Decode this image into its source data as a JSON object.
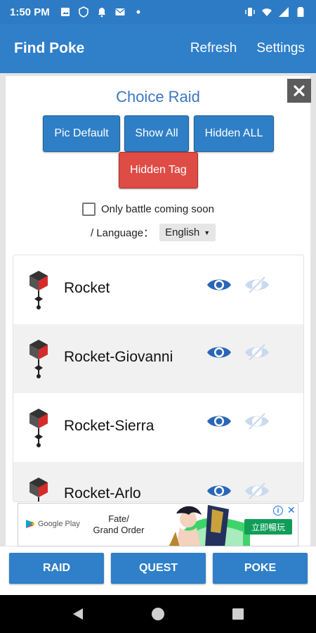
{
  "status_bar": {
    "time": "1:50 PM",
    "left_icons": [
      "photo-icon",
      "shield-icon",
      "bell-icon",
      "mail-icon",
      "dot-icon"
    ],
    "right_icons": [
      "vibrate-icon",
      "wifi-icon",
      "signal-icon",
      "battery-icon"
    ]
  },
  "app_bar": {
    "title": "Find Poke",
    "actions": [
      "Refresh",
      "Settings"
    ]
  },
  "dialog": {
    "title": "Choice Raid",
    "buttons": {
      "pic_default": "Pic Default",
      "show_all": "Show All",
      "hidden_all": "Hidden ALL",
      "hidden_tag": "Hidden Tag"
    },
    "checkbox_label": "Only battle coming soon",
    "checkbox_checked": false,
    "language_label": "/  Language：",
    "language_value": "English",
    "items": [
      {
        "label": "Rocket"
      },
      {
        "label": "Rocket-Giovanni"
      },
      {
        "label": "Rocket-Sierra"
      },
      {
        "label": "Rocket-Arlo"
      }
    ]
  },
  "ad": {
    "store": "Google Play",
    "title_line1": "Fate/",
    "title_line2": "Grand Order",
    "cta": "立即暢玩",
    "info": "i",
    "close": "✕"
  },
  "bottom_tabs": [
    "RAID",
    "QUEST",
    "POKE"
  ],
  "colors": {
    "primary": "#2f7fc9",
    "danger": "#de4c45",
    "eye_active": "#2a66b8",
    "eye_inactive": "#c9d9ef"
  }
}
